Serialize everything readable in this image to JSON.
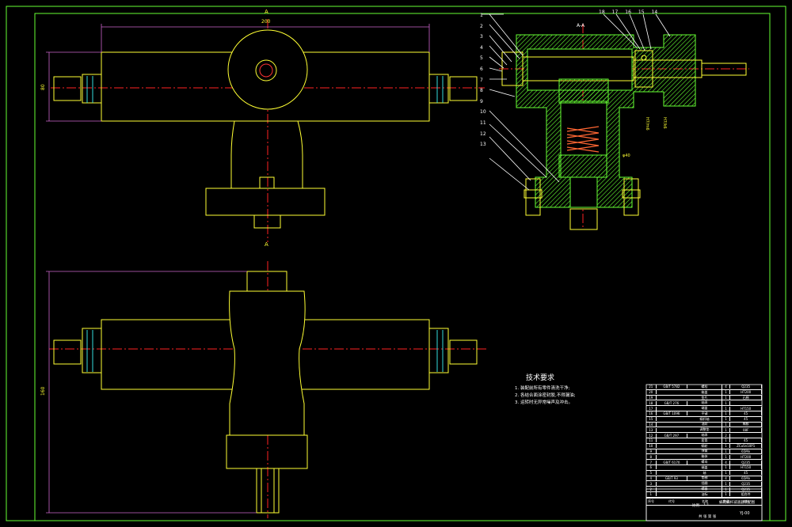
{
  "tech_requirements": {
    "title": "技术要求",
    "items": [
      "1. 装配前所有零件清洗干净;",
      "2. 各结合面涂密封胶,不得漏油;",
      "3. 运转时无异常噪声及冲击。"
    ]
  },
  "section_label": "A-A",
  "view_marks": {
    "top": "A",
    "bottom": "A"
  },
  "dimensions": {
    "top_width": "200",
    "left_height": "80",
    "bottom_height": "160"
  },
  "callouts_left": [
    "1",
    "2",
    "3",
    "4",
    "5",
    "6",
    "7",
    "8",
    "9",
    "10",
    "11",
    "12",
    "13"
  ],
  "callouts_top": [
    "18",
    "17",
    "16",
    "15",
    "14"
  ],
  "fit_labels": [
    "H7/m6",
    "H7/k6",
    "φ40"
  ],
  "bom_rows": [
    [
      "21",
      "GB/T 5782",
      "螺栓",
      "4",
      "Q235"
    ],
    [
      "20",
      "",
      "箱盖",
      "1",
      "HT200"
    ],
    [
      "19",
      "",
      "垫片",
      "1",
      "石棉"
    ],
    [
      "18",
      "GB/T 276",
      "轴承",
      "1",
      ""
    ],
    [
      "17",
      "",
      "端盖",
      "1",
      "HT150"
    ],
    [
      "16",
      "GB/T 1096",
      "平键",
      "1",
      "45"
    ],
    [
      "15",
      "",
      "蜗杆轴",
      "1",
      "45"
    ],
    [
      "14",
      "",
      "油封",
      "1",
      "橡胶"
    ],
    [
      "13",
      "",
      "调整垫",
      "1",
      "08F"
    ],
    [
      "12",
      "GB/T 297",
      "轴承",
      "2",
      ""
    ],
    [
      "11",
      "",
      "套筒",
      "1",
      "45"
    ],
    [
      "10",
      "",
      "蜗轮",
      "1",
      "ZCuSn10P1"
    ],
    [
      "9",
      "",
      "弹簧",
      "1",
      "65Mn"
    ],
    [
      "8",
      "",
      "箱体",
      "1",
      "HT200"
    ],
    [
      "7",
      "GB/T 6170",
      "螺母",
      "4",
      "Q235"
    ],
    [
      "6",
      "",
      "端盖",
      "1",
      "HT150"
    ],
    [
      "5",
      "",
      "轴",
      "1",
      "45"
    ],
    [
      "4",
      "GB/T 93",
      "垫圈",
      "4",
      "65Mn"
    ],
    [
      "3",
      "",
      "挡圈",
      "1",
      "Q235"
    ],
    [
      "2",
      "",
      "螺塞",
      "1",
      "Q235"
    ],
    [
      "1",
      "",
      "油标",
      "1",
      "组合件"
    ]
  ],
  "bom_header": [
    "序号",
    "代号",
    "名称",
    "数量",
    "材料"
  ],
  "title_block": {
    "drawing_name": "蜗轮蜗杆减速器装配图",
    "drawing_no": "YJ-00",
    "scale_label": "比例",
    "scale_value": "1:1",
    "sheet_label": "共 张 第 张"
  },
  "colors": {
    "yellow": "#ffff33",
    "green": "#66ff33",
    "red": "#ff2222",
    "cyan": "#33dddd",
    "magenta": "#cc66cc"
  }
}
